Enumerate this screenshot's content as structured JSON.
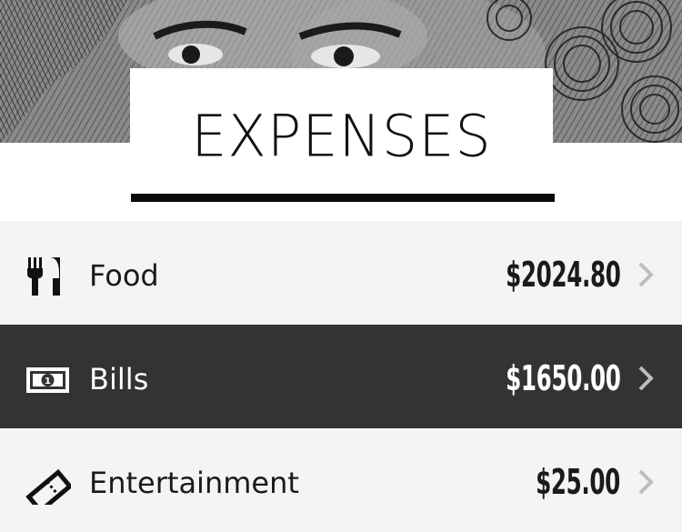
{
  "header": {
    "title": "EXPENSES"
  },
  "colors": {
    "row_light": "#f4f4f4",
    "row_dark": "#333333",
    "chevron": "#bdbdbd",
    "text_dark": "#1a1a1a",
    "text_light": "#ffffff"
  },
  "expenses": [
    {
      "label": "Food",
      "amount": "$2024.80",
      "icon": "fork-knife-icon"
    },
    {
      "label": "Bills",
      "amount": "$1650.00",
      "icon": "banknote-icon"
    },
    {
      "label": "Entertainment",
      "amount": "$25.00",
      "icon": "ticket-icon"
    }
  ]
}
